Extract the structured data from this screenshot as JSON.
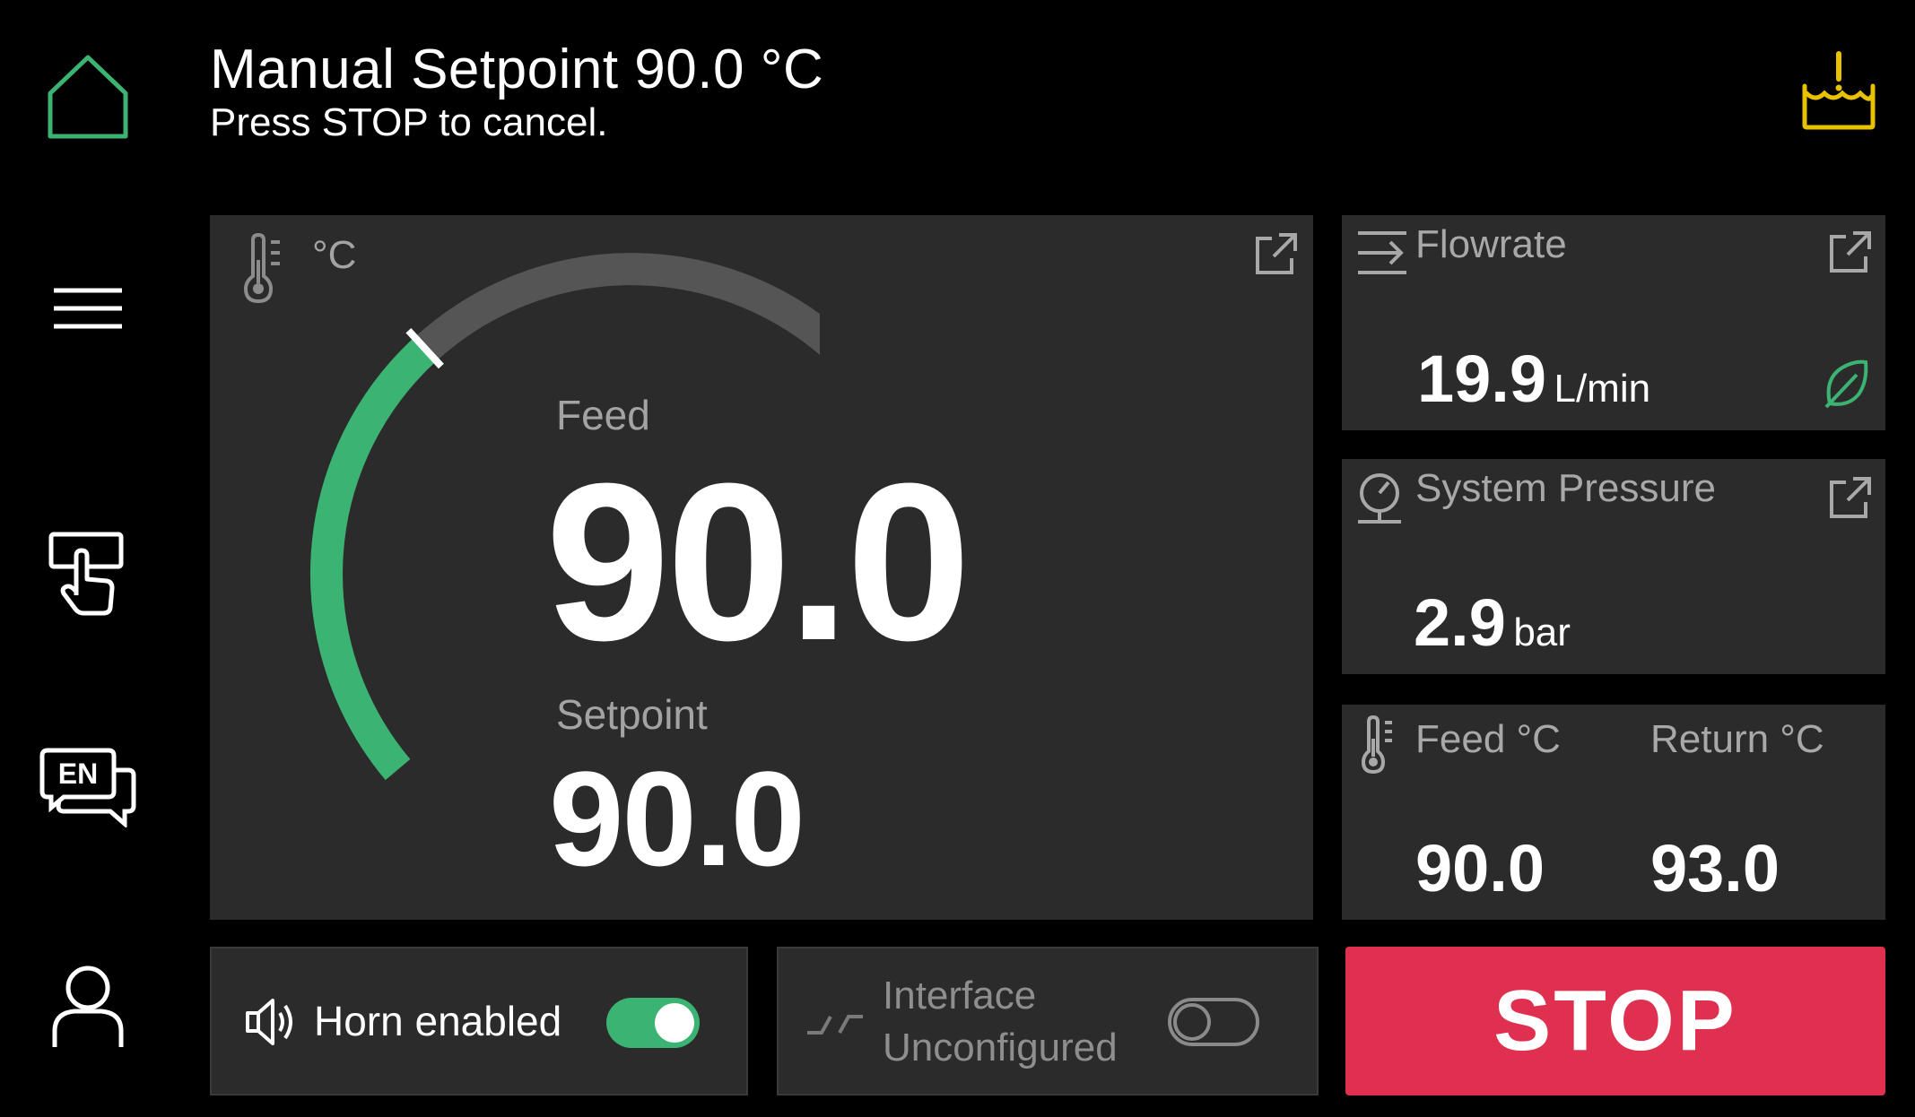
{
  "header": {
    "title": "Manual Setpoint 90.0 °C",
    "subtitle": "Press STOP to cancel."
  },
  "sidebar": {
    "items": [
      {
        "name": "home-icon"
      },
      {
        "name": "menu-icon"
      },
      {
        "name": "touch-control-icon"
      },
      {
        "name": "language-icon",
        "label": "EN"
      },
      {
        "name": "user-icon"
      }
    ]
  },
  "alert_icon": "tank-level-warning-icon",
  "temperature_card": {
    "unit": "°C",
    "feed_label": "Feed",
    "feed_value": "90.0",
    "setpoint_label": "Setpoint",
    "setpoint_value": "90.0",
    "gauge_fraction": 0.5
  },
  "flowrate_card": {
    "label": "Flowrate",
    "value": "19.9",
    "unit": "L/min",
    "status_icon": "leaf-icon"
  },
  "pressure_card": {
    "label": "System Pressure",
    "value": "2.9",
    "unit": "bar"
  },
  "feed_return_card": {
    "feed_label": "Feed °C",
    "feed_value": "90.0",
    "return_label": "Return °C",
    "return_value": "93.0"
  },
  "horn": {
    "label": "Horn enabled",
    "enabled": true
  },
  "interface": {
    "label_line1": "Interface",
    "label_line2": "Unconfigured",
    "enabled": false
  },
  "stop_button": {
    "label": "STOP"
  },
  "colors": {
    "accent_green": "#3bb372",
    "stop_red": "#e0304f",
    "alert_yellow": "#e8c200",
    "panel": "#2b2b2b"
  }
}
